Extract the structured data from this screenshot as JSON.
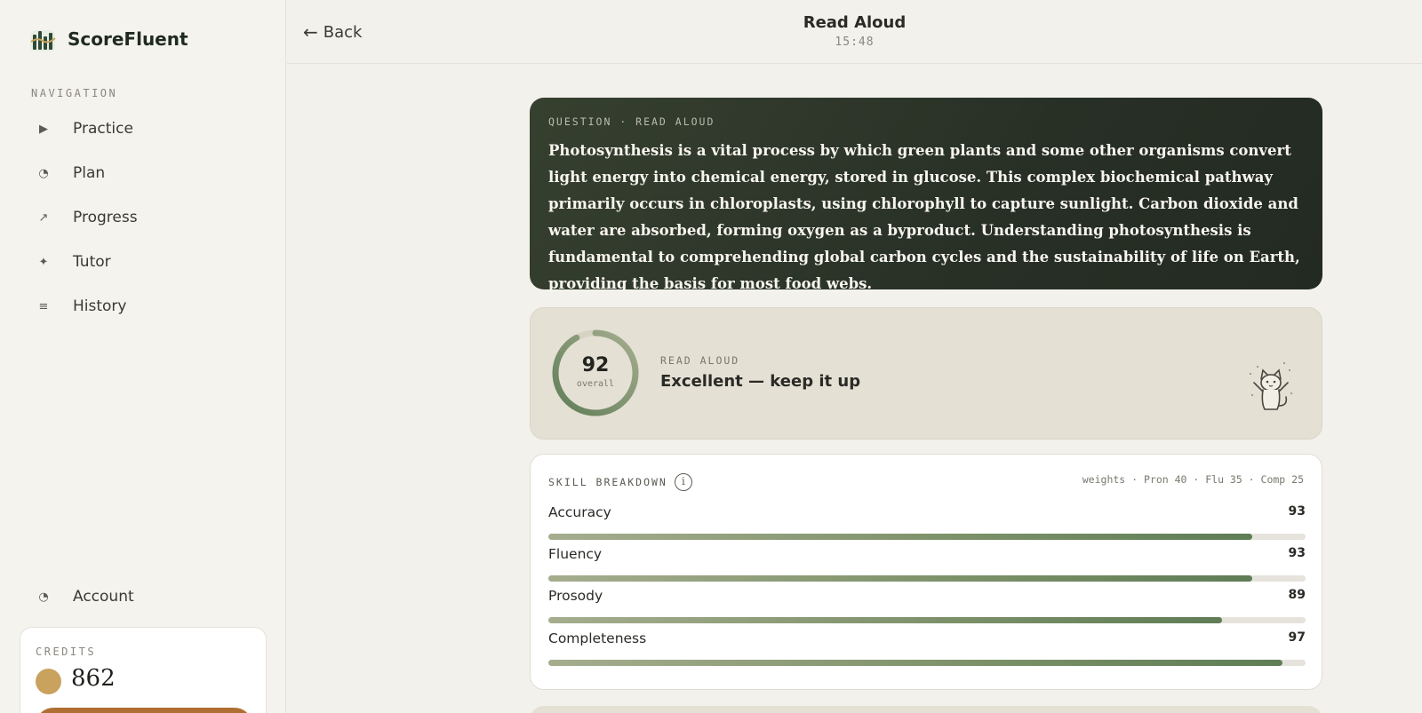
{
  "app": {
    "name": "ScoreFluent"
  },
  "sidebar": {
    "nav_heading": "NAVIGATION",
    "items": [
      {
        "label": "Practice",
        "icon": "play-icon"
      },
      {
        "label": "Plan",
        "icon": "pie-icon"
      },
      {
        "label": "Progress",
        "icon": "arrow-up-right-icon"
      },
      {
        "label": "Tutor",
        "icon": "sparkle-icon"
      },
      {
        "label": "History",
        "icon": "list-icon"
      }
    ],
    "account": {
      "label": "Account",
      "icon": "pie-icon"
    },
    "credits": {
      "label": "CREDITS",
      "value": "862",
      "coin_color": "#c9a25e",
      "button_color": "#b06f32"
    }
  },
  "topbar": {
    "back_label": "Back",
    "title": "Read Aloud",
    "timer": "15:48"
  },
  "question": {
    "label": "QUESTION · READ ALOUD",
    "text": "Photosynthesis is a vital process by which green plants and some other organisms convert light energy into chemical energy, stored in glucose. This complex biochemical pathway primarily occurs in chloroplasts, using chlorophyll to capture sunlight. Carbon dioxide and water are absorbed, forming oxygen as a byproduct. Understanding photosynthesis is fundamental to comprehending global carbon cycles and the sustainability of life on Earth, providing the basis for most food webs."
  },
  "score": {
    "overall": 92,
    "overall_text": "92",
    "overall_label": "overall",
    "kicker": "READ ALOUD",
    "verdict": "Excellent — keep it up"
  },
  "breakdown": {
    "title": "SKILL BREAKDOWN",
    "weights": "weights · Pron 40 · Flu 35 · Comp 25",
    "skills": [
      {
        "name": "Accuracy",
        "value": 93,
        "value_text": "93"
      },
      {
        "name": "Fluency",
        "value": 93,
        "value_text": "93"
      },
      {
        "name": "Prosody",
        "value": 89,
        "value_text": "89"
      },
      {
        "name": "Completeness",
        "value": 97,
        "value_text": "97"
      }
    ]
  },
  "colors": {
    "accent": "#5f7d56",
    "question_bg": "#283026",
    "score_bg": "#e4e0d4"
  }
}
